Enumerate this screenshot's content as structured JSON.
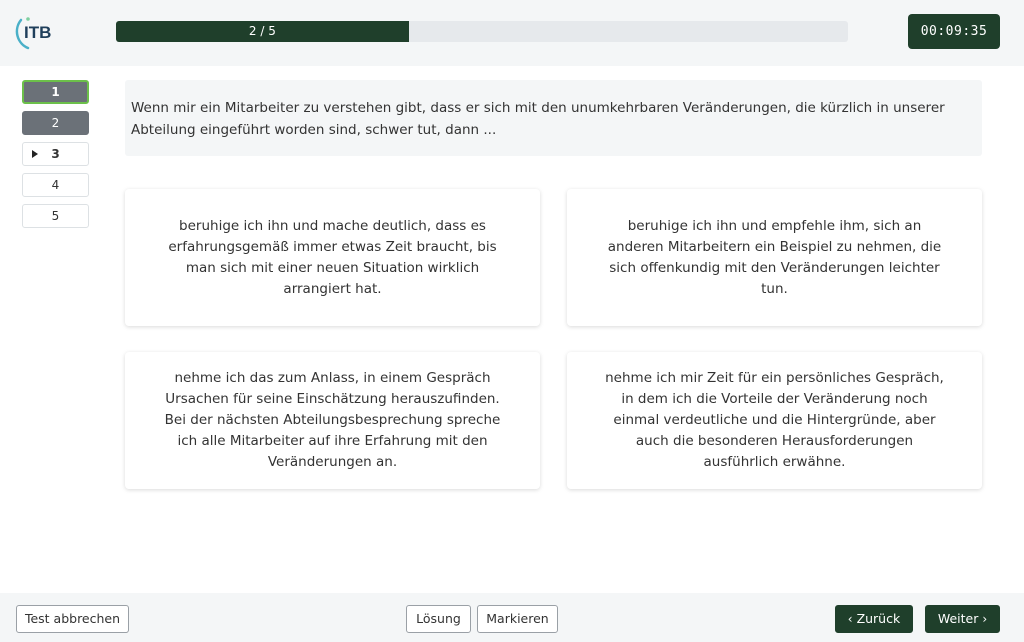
{
  "header": {
    "logo_text": "ITB",
    "progress": {
      "current": 2,
      "total": 5,
      "label": "2 / 5"
    },
    "timer": "00:09:35"
  },
  "nav": {
    "items": [
      {
        "label": "1",
        "state": "answered-current"
      },
      {
        "label": "2",
        "state": "answered"
      },
      {
        "label": "3",
        "state": "active"
      },
      {
        "label": "4",
        "state": "open"
      },
      {
        "label": "5",
        "state": "open"
      }
    ]
  },
  "question": {
    "text": "Wenn mir ein Mitarbeiter zu verstehen gibt, dass er sich mit den unumkehrbaren Veränderungen, die kürzlich in unserer Abteilung eingeführt worden sind, schwer tut, dann ..."
  },
  "answers": [
    {
      "text": "beruhige ich ihn und mache deutlich, dass es erfahrungsgemäß immer etwas Zeit braucht, bis man sich mit einer neuen Situation wirklich arrangiert hat."
    },
    {
      "text": "beruhige ich ihn und empfehle ihm, sich an anderen Mitarbeitern ein Beispiel zu nehmen, die sich offenkundig mit den Veränderungen leichter tun."
    },
    {
      "text": "nehme ich das zum Anlass, in einem Gespräch Ursachen für seine Einschätzung herauszufinden. Bei der nächsten Abteilungsbesprechung spreche ich alle Mitarbeiter auf ihre Erfahrung mit den Veränderungen an."
    },
    {
      "text": "nehme ich mir Zeit für ein persönliches Gespräch, in dem ich die Vorteile der Veränderung noch einmal verdeutliche und die Hintergründe, aber auch die besonderen Herausforderungen ausführlich erwähne."
    }
  ],
  "footer": {
    "cancel_label": "Test abbrechen",
    "solution_label": "Lösung",
    "mark_label": "Markieren",
    "back_label": "Zurück",
    "next_label": "Weiter"
  },
  "icons": {
    "back": "chevron-left-icon",
    "next": "chevron-right-icon",
    "current": "caret-right-icon"
  },
  "colors": {
    "brand_dark": "#1f3f2b",
    "answered_grey": "#6b7178",
    "current_outline": "#6cc04a",
    "logo_arc": "#4ab0c8"
  }
}
